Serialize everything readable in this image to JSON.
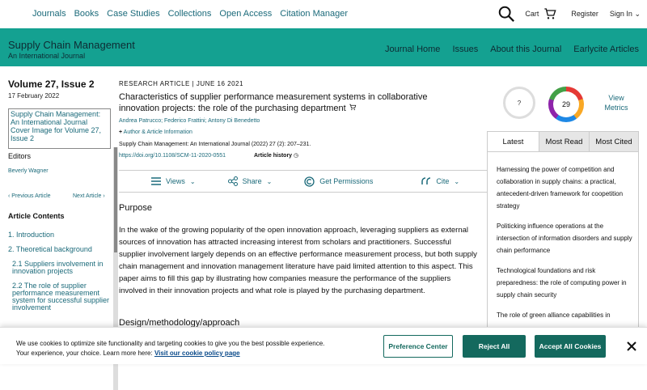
{
  "topnav": {
    "links": [
      "Journals",
      "Books",
      "Case Studies",
      "Collections",
      "Open Access",
      "Citation Manager"
    ],
    "cart": "Cart",
    "register": "Register",
    "signin": "Sign In"
  },
  "journal": {
    "title": "Supply Chain Management",
    "subtitle": "An International Journal",
    "nav": [
      "Journal Home",
      "Issues",
      "About this Journal",
      "Earlycite Articles"
    ]
  },
  "sidebar": {
    "volume": "Volume 27, Issue 2",
    "date": "17 February 2022",
    "cover_alt": "Supply Chain Management: An International Journal Cover Image for Volume 27, Issue 2",
    "editors_label": "Editors",
    "editor": "Beverly Wagner",
    "prev": "Previous Article",
    "next": "Next Article",
    "contents_label": "Article Contents",
    "toc": [
      "1. Introduction",
      "2. Theoretical background",
      "2.1 Suppliers involvement in innovation projects",
      "2.2 The role of supplier performance measurement system for successful supplier involvement"
    ]
  },
  "article": {
    "label": "RESEARCH ARTICLE  |  JUNE 16 2021",
    "title": "Characteristics of supplier performance measurement systems in collaborative innovation projects: the role of the purchasing department",
    "authors": "Andrea Patrucco; Federico Frattini; Antony Di Benedetto",
    "author_info": "Author & Article Information",
    "citation": "Supply Chain Management: An International Journal (2022) 27 (2): 207–231.",
    "doi": "https://doi.org/10.1108/SCM-11-2020-0551",
    "history": "Article history",
    "toolbar": {
      "views": "Views",
      "share": "Share",
      "permissions": "Get Permissions",
      "cite": "Cite"
    },
    "purpose_heading": "Purpose",
    "purpose_text": "In the wake of the growing popularity of the open innovation approach, leveraging suppliers as external sources of innovation has attracted increasing interest from scholars and practitioners. Successful supplier involvement largely depends on an effective performance measurement process, but both supply chain management and innovation management literature have paid limited attention to this aspect. This paper aims to fill this gap by illustrating how companies measure the performance of the suppliers involved in their innovation projects and what role is played by the purchasing department.",
    "design_heading": "Design/methodology/approach"
  },
  "metrics": {
    "altmetric1": "?",
    "altmetric2": "29",
    "view_metrics": "View Metrics"
  },
  "tabs": [
    "Latest",
    "Most Read",
    "Most Cited"
  ],
  "latest": [
    "Harnessing the power of competition and collaboration in supply chains: a practical, antecedent-driven framework for coopetition strategy",
    "Politicking influence operations at the intersection of information disorders and supply chain performance",
    "Technological foundations and risk preparedness: the role of computing power in supply chain security",
    "The role of green alliance capabilities in"
  ],
  "cookie": {
    "line1": "We use cookies to optimize site functionality and targeting cookies to give you the best possible experience.",
    "line2": "Your experience, your choice. Learn more here:",
    "link": "Visit our cookie policy page",
    "preference": "Preference Center",
    "reject": "Reject All",
    "accept": "Accept All Cookies"
  },
  "colors": {
    "teal": "#14a191",
    "link": "#1b6a7a",
    "button": "#14695e"
  }
}
